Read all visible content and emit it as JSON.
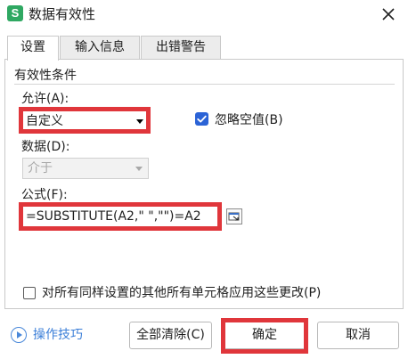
{
  "window": {
    "title": "数据有效性",
    "icon_letter": "S",
    "icon_color": "#2fa862"
  },
  "tabs": [
    {
      "label": "设置",
      "active": true
    },
    {
      "label": "输入信息",
      "active": false
    },
    {
      "label": "出错警告",
      "active": false
    }
  ],
  "settings": {
    "group_label": "有效性条件",
    "allow_label": "允许(A):",
    "allow_value": "自定义",
    "ignore_blank_label": "忽略空值(B)",
    "ignore_blank_checked": true,
    "data_label": "数据(D):",
    "data_value": "介于",
    "formula_label": "公式(F):",
    "formula_value": "=SUBSTITUTE(A2,\" \",\"\")=A2",
    "apply_all_label": "对所有同样设置的其他所有单元格应用这些更改(P)",
    "apply_all_checked": false
  },
  "footer": {
    "tips_label": "操作技巧",
    "clear_all_label": "全部清除(C)",
    "ok_label": "确定",
    "cancel_label": "取消"
  },
  "colors": {
    "highlight": "#e0363b",
    "accent": "#2b63d6",
    "link": "#3c7fd8"
  }
}
